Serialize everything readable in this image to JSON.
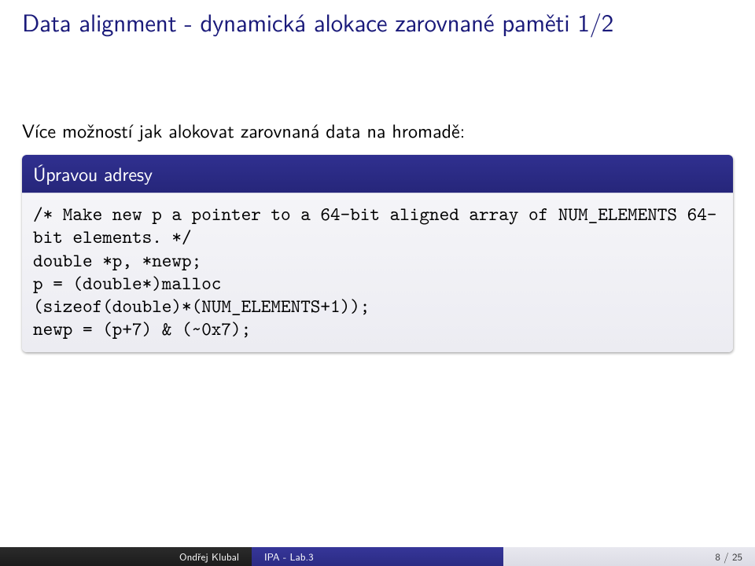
{
  "title": "Data alignment - dynamická alokace zarovnané paměti 1/2",
  "lead": "Více možností jak alokovat zarovnaná data na hromadě:",
  "block": {
    "header": "Úpravou adresy",
    "code": "/* Make new p a pointer to a 64-bit aligned array of NUM_ELEMENTS 64-bit elements. */\ndouble *p, *newp;\np = (double*)malloc\n(sizeof(double)*(NUM_ELEMENTS+1));\nnewp = (p+7) & (~0x7);"
  },
  "footer": {
    "author": "Ondřej Klubal",
    "short_title": "IPA - Lab.3",
    "page": "8 / 25"
  }
}
